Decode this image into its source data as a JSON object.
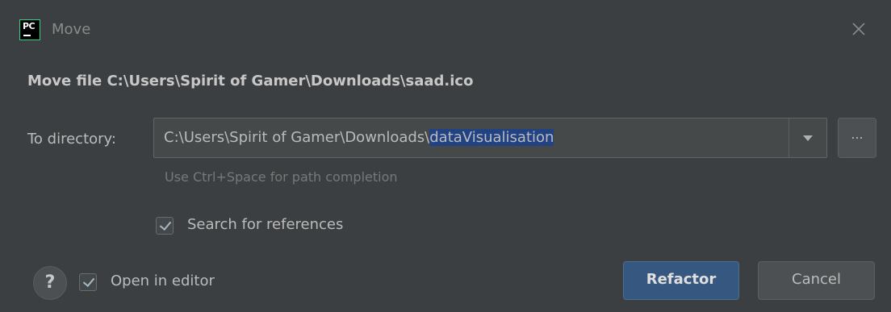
{
  "window": {
    "app_icon_text": "PC",
    "title": "Move",
    "close_icon": "close-icon"
  },
  "header": {
    "text": "Move file C:\\Users\\Spirit of Gamer\\Downloads\\saad.ico"
  },
  "directory": {
    "label": "To directory:",
    "value_prefix": "C:\\Users\\Spirit of Gamer\\Downloads\\",
    "value_selected": "dataVisualisation",
    "dropdown_icon": "chevron-down-icon",
    "browse_label": "...",
    "hint": "Use Ctrl+Space for path completion"
  },
  "options": {
    "search_references": {
      "label": "Search for references",
      "checked": true
    },
    "open_in_editor": {
      "label": "Open in editor",
      "checked": true
    }
  },
  "help": {
    "label": "?"
  },
  "buttons": {
    "refactor": "Refactor",
    "cancel": "Cancel"
  },
  "colors": {
    "background": "#3c3f41",
    "primary_button": "#365880",
    "selection": "#214283"
  }
}
